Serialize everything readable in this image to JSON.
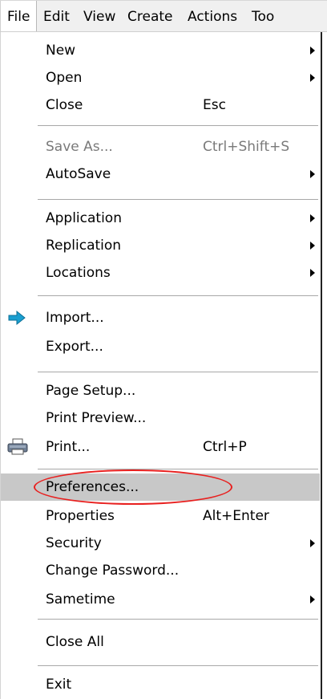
{
  "menubar": {
    "items": [
      {
        "label": "File"
      },
      {
        "label": "Edit"
      },
      {
        "label": "View"
      },
      {
        "label": "Create"
      },
      {
        "label": "Actions"
      },
      {
        "label": "Too"
      }
    ]
  },
  "file_menu": {
    "new": {
      "label": "New"
    },
    "open": {
      "label": "Open"
    },
    "close": {
      "label": "Close",
      "shortcut": "Esc"
    },
    "save_as": {
      "label": "Save As...",
      "shortcut": "Ctrl+Shift+S",
      "disabled": true
    },
    "autosave": {
      "label": "AutoSave"
    },
    "application": {
      "label": "Application"
    },
    "replication": {
      "label": "Replication"
    },
    "locations": {
      "label": "Locations"
    },
    "import": {
      "label": "Import...",
      "icon": "import-arrow-icon"
    },
    "export": {
      "label": "Export..."
    },
    "page_setup": {
      "label": "Page Setup..."
    },
    "print_preview": {
      "label": "Print Preview..."
    },
    "print": {
      "label": "Print...",
      "shortcut": "Ctrl+P",
      "icon": "printer-icon"
    },
    "preferences": {
      "label": "Preferences...",
      "highlighted": true
    },
    "properties": {
      "label": "Properties",
      "shortcut": "Alt+Enter"
    },
    "security": {
      "label": "Security"
    },
    "change_password": {
      "label": "Change Password..."
    },
    "sametime": {
      "label": "Sametime"
    },
    "close_all": {
      "label": "Close All"
    },
    "exit": {
      "label": "Exit"
    }
  },
  "colors": {
    "highlight_bg": "#c8c8c8",
    "annotation_ring": "#e8201f",
    "import_arrow": "#1a9fd0",
    "disabled_text": "#7a7a7a"
  }
}
